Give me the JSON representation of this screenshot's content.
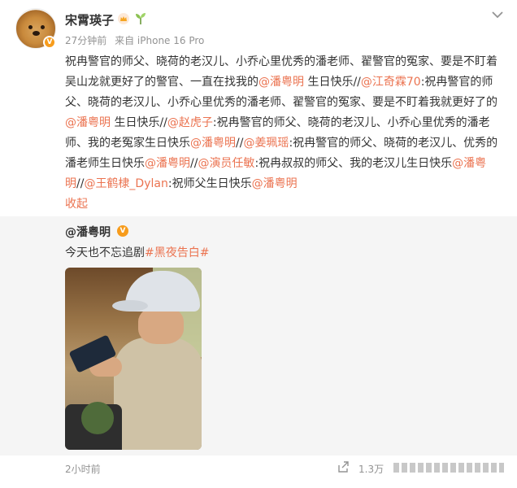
{
  "author": {
    "name": "宋霄瑛子",
    "time": "27分钟前",
    "source": "来自 iPhone 16 Pro"
  },
  "post": {
    "segments": [
      {
        "t": "祝冉警官的师父、晓荷的老汉儿、小乔心里优秀的潘老师、翟警官的冤家、要是不盯着吴山龙就更好了的警官、一直在找我的",
        "at": false
      },
      {
        "t": "@潘粤明",
        "at": true
      },
      {
        "t": " 生日快乐//",
        "at": false
      },
      {
        "t": "@江奇霖70",
        "at": true
      },
      {
        "t": ":祝冉警官的师父、晓荷的老汉儿、小乔心里优秀的潘老师、翟警官的冤家、要是不盯着我就更好了的",
        "at": false
      },
      {
        "t": "@潘粤明",
        "at": true
      },
      {
        "t": " 生日快乐//",
        "at": false
      },
      {
        "t": "@赵虎子",
        "at": true
      },
      {
        "t": ":祝冉警官的师父、晓荷的老汉儿、小乔心里优秀的潘老师、我的老冤家生日快乐",
        "at": false
      },
      {
        "t": "@潘粤明",
        "at": true
      },
      {
        "t": "//",
        "at": false
      },
      {
        "t": "@姜珮瑶",
        "at": true
      },
      {
        "t": ":祝冉警官的师父、晓荷的老汉儿、优秀的潘老师生日快乐",
        "at": false
      },
      {
        "t": "@潘粤明",
        "at": true
      },
      {
        "t": "//",
        "at": false
      },
      {
        "t": "@演员任敏",
        "at": true
      },
      {
        "t": ":祝冉叔叔的师父、我的老汉儿生日快乐",
        "at": false
      },
      {
        "t": "@潘粤明",
        "at": true
      },
      {
        "t": "//",
        "at": false
      },
      {
        "t": "@王鹤棣_Dylan",
        "at": true
      },
      {
        "t": ":祝师父生日快乐",
        "at": false
      },
      {
        "t": "@潘粤明",
        "at": true
      }
    ],
    "collapse_label": "收起"
  },
  "repost": {
    "user": "@潘粤明",
    "text": "今天也不忘追剧",
    "tag": "#黑夜告白#"
  },
  "footer": {
    "time": "2小时前",
    "share_count": "1.3万"
  },
  "colors": {
    "accent": "#eb7350",
    "meta": "#939393",
    "repost_bg": "#f5f5f5",
    "badge": "#f79c1c"
  },
  "icons": [
    "crown-icon",
    "sprout-icon",
    "more-icon",
    "verified-icon",
    "share-icon"
  ]
}
